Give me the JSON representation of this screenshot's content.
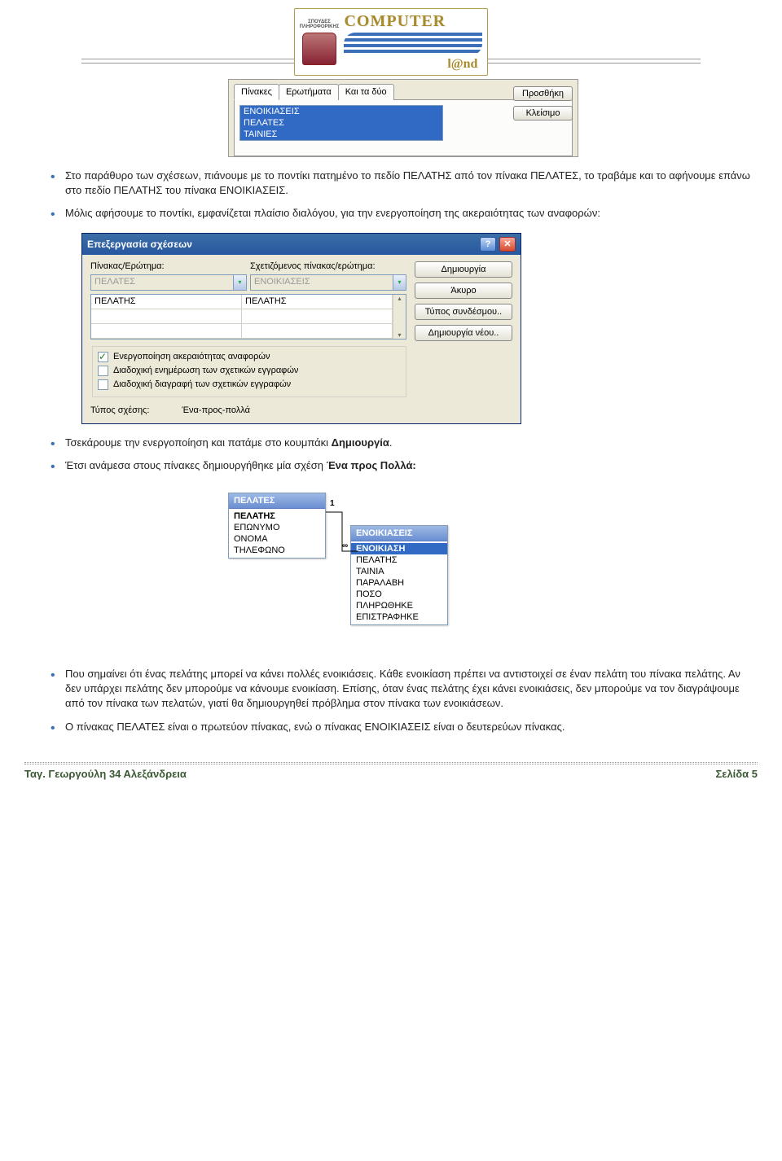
{
  "header": {
    "badge_line1": "ΣΠΟΥΔΕΣ",
    "badge_line2": "ΠΛΗΡΟΦΟΡΙΚΗΣ",
    "logo_top": "COMPUTER",
    "logo_bottom": "l@nd"
  },
  "ui1": {
    "tabs": [
      "Πίνακες",
      "Ερωτήματα",
      "Και τα δύο"
    ],
    "list": [
      "ΕΝΟΙΚΙΑΣΕΙΣ",
      "ΠΕΛΑΤΕΣ",
      "ΤΑΙΝΙΕΣ"
    ],
    "btn_add": "Προσθήκη",
    "btn_close": "Κλείσιμο"
  },
  "bullets": {
    "b1": "Στο παράθυρο των σχέσεων, πιάνουμε με το ποντίκι πατημένο το πεδίο ΠΕΛΑΤΗΣ από τον πίνακα ΠΕΛΑΤΕΣ, το τραβάμε και το αφήνουμε επάνω στο πεδίο ΠΕΛΑΤΗΣ του πίνακα ΕΝΟΙΚΙΑΣΕΙΣ.",
    "b2": "Μόλις αφήσουμε το ποντίκι, εμφανίζεται πλαίσιο διαλόγου, για την ενεργοποίηση της ακεραιότητας των αναφορών:",
    "b3a": "Τσεκάρουμε την ενεργοποίηση και πατάμε στο κουμπάκι ",
    "b3b": "Δημιουργία",
    "b3c": ".",
    "b4a": "Έτσι ανάμεσα στους πίνακες δημιουργήθηκε μία σχέση ",
    "b4b": "Ένα προς Πολλά:",
    "b5": "Που σημαίνει ότι ένας πελάτης μπορεί να κάνει πολλές ενοικιάσεις. Κάθε ενοικίαση πρέπει να αντιστοιχεί σε έναν πελάτη του πίνακα πελάτης. Αν δεν υπάρχει πελάτης δεν μπορούμε να κάνουμε ενοικίαση. Επίσης, όταν ένας πελάτης έχει κάνει ενοικιάσεις, δεν μπορούμε να τον διαγράψουμε από τον πίνακα των πελατών, γιατί θα δημιουργηθεί πρόβλημα στον πίνακα των ενοικιάσεων.",
    "b6": "Ο πίνακας ΠΕΛΑΤΕΣ είναι ο πρωτεύον πίνακας, ενώ ο πίνακας ΕΝΟΙΚΙΑΣΕΙΣ είναι ο δευτερεύων πίνακας."
  },
  "dialog": {
    "title": "Επεξεργασία σχέσεων",
    "lbl_table": "Πίνακας/Ερώτημα:",
    "lbl_related": "Σχετιζόμενος πίνακας/ερώτημα:",
    "combo_left": "ΠΕΛΑΤΕΣ",
    "combo_right": "ΕΝΟΙΚΙΑΣΕΙΣ",
    "cell_left": "ΠΕΛΑΤΗΣ",
    "cell_right": "ΠΕΛΑΤΗΣ",
    "chk1": "Ενεργοποίηση ακεραιότητας αναφορών",
    "chk2": "Διαδοχική ενημέρωση των σχετικών εγγραφών",
    "chk3": "Διαδοχική διαγραφή των σχετικών εγγραφών",
    "type_lbl": "Τύπος σχέσης:",
    "type_val": "Ένα-προς-πολλά",
    "btn_create": "Δημιουργία",
    "btn_cancel": "Άκυρο",
    "btn_join": "Τύπος συνδέσμου..",
    "btn_new": "Δημιουργία νέου.."
  },
  "rel": {
    "t1_hdr": "ΠΕΛΑΤΕΣ",
    "t1_fields": [
      "ΠΕΛΑΤΗΣ",
      "ΕΠΩΝΥΜΟ",
      "ΟΝΟΜΑ",
      "ΤΗΛΕΦΩΝΟ"
    ],
    "t2_hdr": "ΕΝΟΙΚΙΑΣΕΙΣ",
    "t2_fields": [
      "ΕΝΟΙΚΙΑΣΗ",
      "ΠΕΛΑΤΗΣ",
      "ΤΑΙΝΙΑ",
      "ΠΑΡΑΛΑΒΗ",
      "ΠΟΣΟ",
      "ΠΛΗΡΩΘΗΚΕ",
      "ΕΠΙΣΤΡΑΦΗΚΕ"
    ],
    "one": "1",
    "many": "∞"
  },
  "footer": {
    "left": "Ταγ. Γεωργούλη 34 Αλεξάνδρεια",
    "right": "Σελίδα 5"
  }
}
